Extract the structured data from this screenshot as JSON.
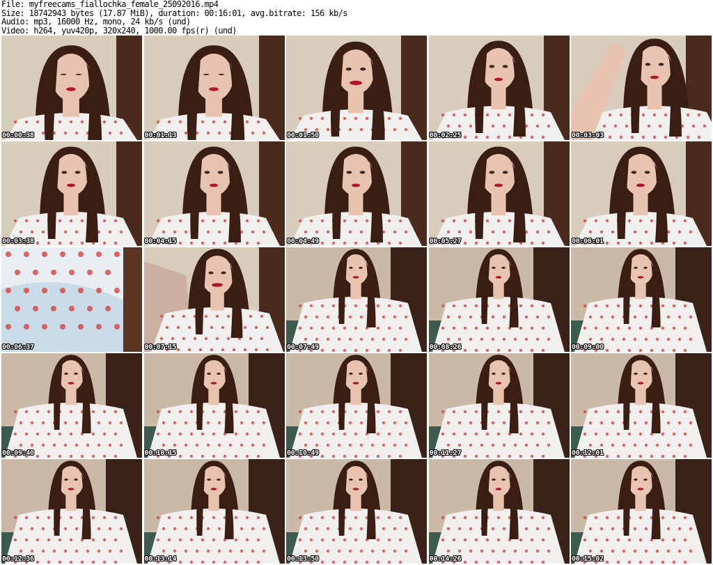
{
  "header": {
    "file_line": "File: myfreecams_fiallochka_female_25092016.mp4",
    "size_line": "Size: 18742943 bytes (17.87 MiB), duration: 00:16:01, avg.bitrate: 156 kb/s",
    "audio_line": "Audio: mp3, 16000 Hz, mono, 24 kb/s (und)",
    "video_line": "Video: h264, yuv420p, 320x240, 1000.00 fps(r) (und)"
  },
  "thumbnails": [
    {
      "time": "00:00:38",
      "scene": "head-down"
    },
    {
      "time": "00:01:13",
      "scene": "head-down"
    },
    {
      "time": "00:01:50",
      "scene": "smile"
    },
    {
      "time": "00:02:25",
      "scene": "portrait"
    },
    {
      "time": "00:03:03",
      "scene": "arm-raised"
    },
    {
      "time": "00:03:38",
      "scene": "portrait"
    },
    {
      "time": "00:04:15",
      "scene": "portrait"
    },
    {
      "time": "00:04:49",
      "scene": "portrait"
    },
    {
      "time": "00:05:27",
      "scene": "portrait"
    },
    {
      "time": "00:06:01",
      "scene": "portrait"
    },
    {
      "time": "00:06:37",
      "scene": "closeup-fabric"
    },
    {
      "time": "00:07:15",
      "scene": "blur-reach"
    },
    {
      "time": "00:07:49",
      "scene": "seated"
    },
    {
      "time": "00:08:26",
      "scene": "seated"
    },
    {
      "time": "00:09:00",
      "scene": "seated"
    },
    {
      "time": "00:09:40",
      "scene": "seated"
    },
    {
      "time": "00:10:15",
      "scene": "seated"
    },
    {
      "time": "00:10:49",
      "scene": "seated"
    },
    {
      "time": "00:11:27",
      "scene": "seated"
    },
    {
      "time": "00:12:01",
      "scene": "seated"
    },
    {
      "time": "00:12:36",
      "scene": "seated"
    },
    {
      "time": "00:13:14",
      "scene": "seated"
    },
    {
      "time": "00:13:50",
      "scene": "seated"
    },
    {
      "time": "00:14:26",
      "scene": "seated"
    },
    {
      "time": "00:15:02",
      "scene": "seated"
    }
  ],
  "colors": {
    "background": "#ffffff",
    "header_text": "#000000",
    "timestamp_text": "#ffffff",
    "timestamp_outline": "#000000",
    "hair": "#3a1e14",
    "skin": "#e8c4b0",
    "shirt": "#f2f0ee",
    "heart_print": "#d84a4a",
    "lips": "#b0162a"
  }
}
